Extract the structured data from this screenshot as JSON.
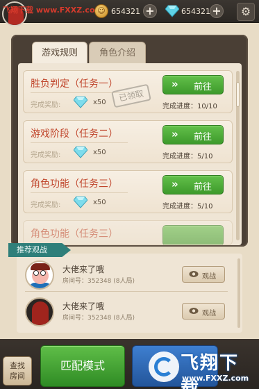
{
  "topbar": {
    "watermark": "飞翔下载 www.FXXZ.com",
    "coins": "654321",
    "diamonds": "654321",
    "plus_label": "+",
    "settings_glyph": "⚙"
  },
  "tabs": [
    {
      "label": "游戏规则",
      "active": true
    },
    {
      "label": "角色介绍",
      "active": false
    }
  ],
  "tasks": [
    {
      "title": "胜负判定（任务一）",
      "reward_label": "完成奖励:",
      "reward_count": "x50",
      "button_label": "前往",
      "progress": "完成进度：10/10",
      "stamp": "已领取"
    },
    {
      "title": "游戏阶段（任务二）",
      "reward_label": "完成奖励:",
      "reward_count": "x50",
      "button_label": "前往",
      "progress": "完成进度：5/10"
    },
    {
      "title": "角色功能（任务三）",
      "reward_label": "完成奖励:",
      "reward_count": "x50",
      "button_label": "前往",
      "progress": "完成进度：5/10"
    },
    {
      "title": "角色功能（任务三）"
    }
  ],
  "recommend": {
    "tag": "推荐观战",
    "rows": [
      {
        "name": "大佬来了哦",
        "room": "房间号：352348 (8人局)",
        "watch_label": "观战"
      },
      {
        "name": "大佬来了哦",
        "room": "房间号：352348 (8人局)",
        "watch_label": "观战"
      }
    ]
  },
  "bottom": {
    "find_room_line1": "查找",
    "find_room_line2": "房间",
    "match_label": "匹配模式"
  },
  "watermark_logo": {
    "text": "飞翔下载",
    "url": "www.FXXZ.com"
  },
  "colors": {
    "accent_green": "#4cae38",
    "title_red": "#c0452b",
    "teal_tag": "#2f7f7a"
  }
}
